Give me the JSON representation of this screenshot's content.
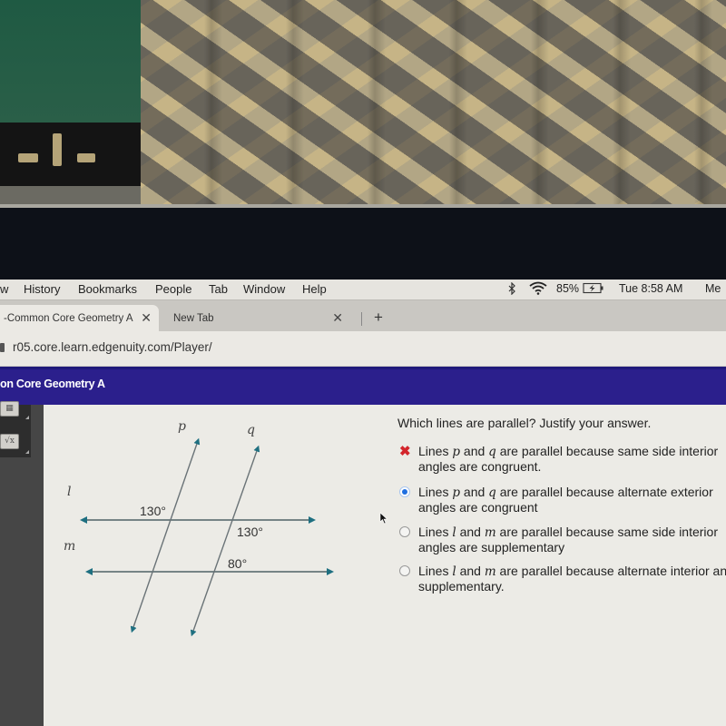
{
  "browser": {
    "menu_items": [
      "w",
      "History",
      "Bookmarks",
      "People",
      "Tab",
      "Window",
      "Help"
    ],
    "status": {
      "bluetooth_icon": "bluetooth-icon",
      "wifi_icon": "wifi-icon",
      "battery_percent": "85%",
      "battery_icon": "battery-charging-icon",
      "clock": "Tue 8:58 AM",
      "overflow_menu": "Me"
    },
    "tabs": [
      {
        "label": "-Common Core Geometry A",
        "active": true,
        "close": "✕"
      },
      {
        "label": "New Tab",
        "active": false,
        "close": "✕"
      }
    ],
    "new_tab_label": "+",
    "url": "r05.core.learn.edgenuity.com/Player/"
  },
  "course": {
    "title": "on Core Geometry A"
  },
  "toolbar": {
    "tools": [
      {
        "name": "calculator-tool",
        "glyph": "▦"
      },
      {
        "name": "sqrt-tool",
        "glyph": "√x"
      }
    ]
  },
  "diagram": {
    "lines": {
      "p": "p",
      "q": "q",
      "l": "l",
      "m": "m"
    },
    "angles": {
      "p_l_upper_left": "130°",
      "q_l_lower_right": "130°",
      "q_m_upper_right": "80°"
    },
    "colors": {
      "arrow": "#1e6f80",
      "line": "#4e6266"
    }
  },
  "question": {
    "prompt": "Which lines are parallel? Justify your answer.",
    "choices": [
      {
        "state": "incorrect",
        "parts": [
          "Lines ",
          "p",
          " and ",
          "q",
          " are parallel because same side interior angles are congruent."
        ]
      },
      {
        "state": "selected",
        "parts": [
          "Lines ",
          "p",
          " and ",
          "q",
          " are parallel because alternate exterior angles are congruent"
        ]
      },
      {
        "state": "unselected",
        "parts": [
          "Lines ",
          "l",
          " and ",
          "m",
          " are parallel because same side interior angles are supplementary"
        ]
      },
      {
        "state": "unselected",
        "parts": [
          "Lines ",
          "l",
          " and ",
          "m",
          " are parallel because alternate interior angles are supplementary."
        ]
      }
    ],
    "incorrect_mark": "✖"
  }
}
